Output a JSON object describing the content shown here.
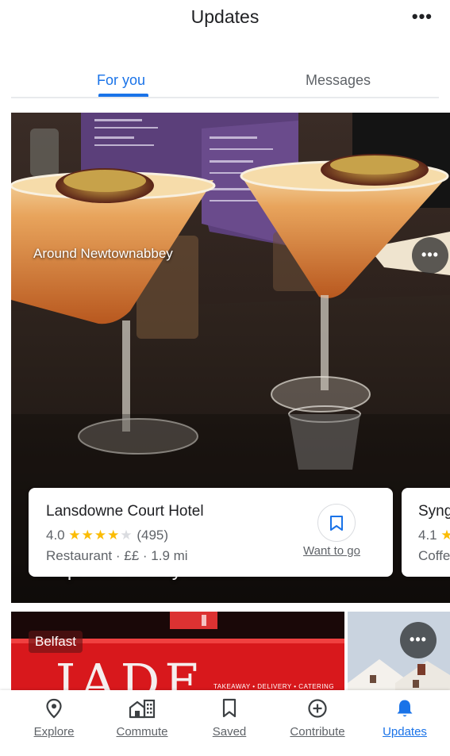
{
  "header": {
    "title": "Updates",
    "more_label": "•••"
  },
  "tabs": [
    {
      "label": "For you",
      "active": true
    },
    {
      "label": "Messages",
      "active": false
    }
  ],
  "hero": {
    "area_label": "Around Newtownabbey",
    "more_label": "•••",
    "caption": "10 photo-worthy dishes"
  },
  "place_card": {
    "name": "Lansdowne Court Hotel",
    "rating": "4.0",
    "stars_filled": "★★★★",
    "stars_empty": "★",
    "reviews": "(495)",
    "meta": "Restaurant · ££ · 1.9 mi",
    "save_label": "Want to go"
  },
  "place_card_2": {
    "name": "Syng",
    "rating": "4.1",
    "star": "★",
    "meta": "Coffe"
  },
  "belfast_card": {
    "label": "Belfast",
    "sign_text": "JADE",
    "sign_subtext": "TAKEAWAY • DELIVERY • CATERING"
  },
  "house_card": {
    "more_label": "•••"
  },
  "bottom_nav": {
    "items": [
      {
        "label": "Explore",
        "icon": "location-pin-icon"
      },
      {
        "label": "Commute",
        "icon": "commute-icon"
      },
      {
        "label": "Saved",
        "icon": "bookmark-icon"
      },
      {
        "label": "Contribute",
        "icon": "add-circle-icon"
      },
      {
        "label": "Updates",
        "icon": "bell-icon",
        "active": true
      }
    ]
  },
  "colors": {
    "accent": "#1a73e8",
    "star": "#fbbc04",
    "text_secondary": "#5f6368"
  }
}
